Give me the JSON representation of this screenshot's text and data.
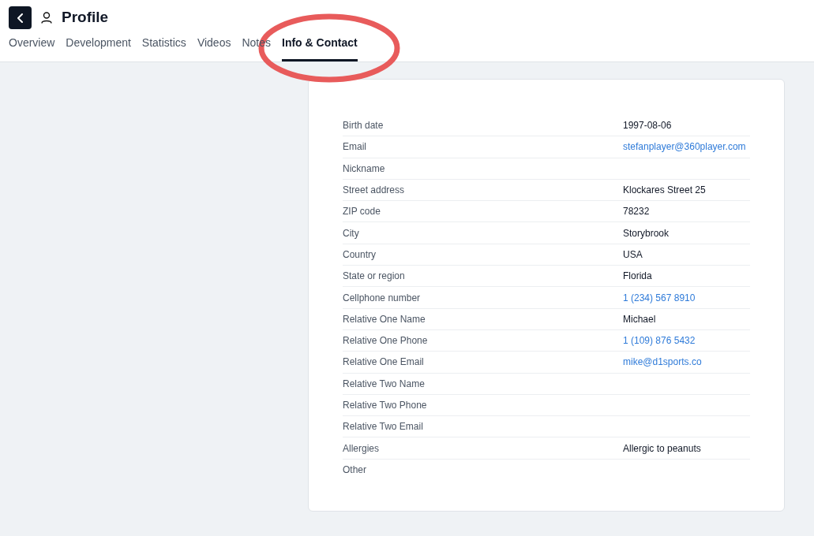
{
  "header": {
    "title": "Profile"
  },
  "tabs": [
    {
      "label": "Overview",
      "selected": false
    },
    {
      "label": "Development",
      "selected": false
    },
    {
      "label": "Statistics",
      "selected": false
    },
    {
      "label": "Videos",
      "selected": false
    },
    {
      "label": "Notes",
      "selected": false
    },
    {
      "label": "Info & Contact",
      "selected": true
    }
  ],
  "annotation": {
    "kind": "ellipse",
    "color": "#e85b5b"
  },
  "info": [
    {
      "label": "Birth date",
      "value": "1997-08-06",
      "kind": "text"
    },
    {
      "label": "Email",
      "value": "stefanplayer@360player.com",
      "kind": "link"
    },
    {
      "label": "Nickname"
    },
    {
      "label": "Street address",
      "value": "Klockares Street 25",
      "kind": "text"
    },
    {
      "label": "ZIP code",
      "value": "78232",
      "kind": "text"
    },
    {
      "label": "City",
      "value": "Storybrook",
      "kind": "text"
    },
    {
      "label": "Country",
      "value": "USA",
      "kind": "text"
    },
    {
      "label": "State or region",
      "value": "Florida",
      "kind": "text"
    },
    {
      "label": "Cellphone number",
      "value": "1 (234) 567 8910",
      "kind": "link"
    },
    {
      "label": "Relative One Name",
      "value": "Michael",
      "kind": "text"
    },
    {
      "label": "Relative One Phone",
      "value": "1 (109) 876 5432",
      "kind": "link"
    },
    {
      "label": "Relative One Email",
      "value": "mike@d1sports.co",
      "kind": "link"
    },
    {
      "label": "Relative Two Name"
    },
    {
      "label": "Relative Two Phone"
    },
    {
      "label": "Relative Two Email"
    },
    {
      "label": "Allergies",
      "value": "Allergic to peanuts",
      "kind": "text"
    },
    {
      "label": "Other"
    }
  ]
}
